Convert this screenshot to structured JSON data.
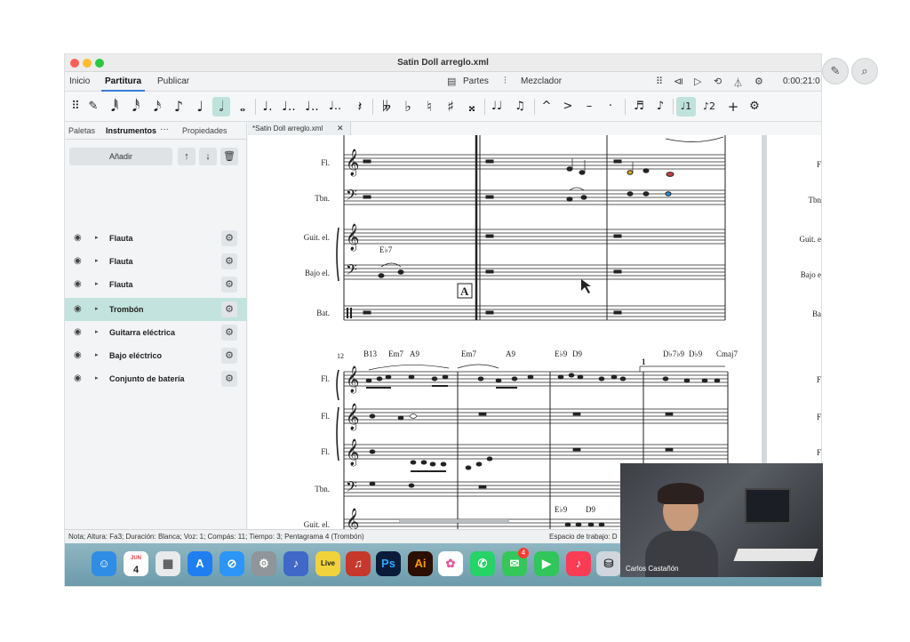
{
  "window": {
    "title": "Satin Doll arreglo.xml"
  },
  "menu": {
    "tabs": [
      {
        "label": "Inicio"
      },
      {
        "label": "Partitura"
      },
      {
        "label": "Publicar"
      }
    ],
    "parts_label": "Partes",
    "mixer_label": "Mezclador",
    "time": "0:00:21:0"
  },
  "notes_toolbar": {
    "voice1": "1",
    "voice2": "2"
  },
  "panel": {
    "tabs": [
      {
        "label": "Paletas"
      },
      {
        "label": "Instrumentos"
      },
      {
        "label": "Propiedades"
      }
    ],
    "add_label": "Añadir",
    "instruments": [
      {
        "name": "Flauta",
        "selected": false
      },
      {
        "name": "Flauta",
        "selected": false
      },
      {
        "name": "Flauta",
        "selected": false
      },
      {
        "name": "Trombón",
        "selected": true
      },
      {
        "name": "Guitarra eléctrica",
        "selected": false
      },
      {
        "name": "Bajo eléctrico",
        "selected": false
      },
      {
        "name": "Conjunto de batería",
        "selected": false
      }
    ]
  },
  "document": {
    "tab_label": "*Satin Doll arreglo.xml"
  },
  "score": {
    "system1": {
      "labels": [
        "Fl.",
        "Tbn.",
        "Guit. el.",
        "Bajo el.",
        "Bat."
      ],
      "chord": "E♭7",
      "rehearsal_mark": "A"
    },
    "system2": {
      "measure_number": "12",
      "labels": [
        "Fl.",
        "Fl.",
        "Fl.",
        "Tbn.",
        "Guit. el."
      ],
      "chords": [
        "B13",
        "Em7",
        "A9",
        "Em7",
        "A9",
        "E♭9",
        "D9",
        "D♭7♭9",
        "D♭9",
        "Cmaj7"
      ],
      "ending": "1",
      "guitar_chords": [
        "E♭9",
        "D9"
      ]
    },
    "right_labels": [
      "F",
      "Tbn",
      "Guit. e",
      "Bajo e",
      "Ba",
      "F",
      "F",
      "F"
    ]
  },
  "status": {
    "left": "Nota; Altura: Fa3; Duración: Blanca; Voz: 1; Compás: 11; Tiempo: 3; Pentagrama 4 (Trombón)",
    "right": "Espacio de trabajo: D"
  },
  "dock": {
    "calendar_month": "JUN",
    "calendar_day": "4",
    "live_label": "Live",
    "ps_label": "Ps",
    "ai_label": "Ai",
    "messages_badge": "4"
  },
  "webcam": {
    "name": "Carlos Castañón"
  },
  "colors": {
    "accent": "#3a7ed6",
    "selection": "#c2e3de",
    "dock": "#7faab8"
  }
}
